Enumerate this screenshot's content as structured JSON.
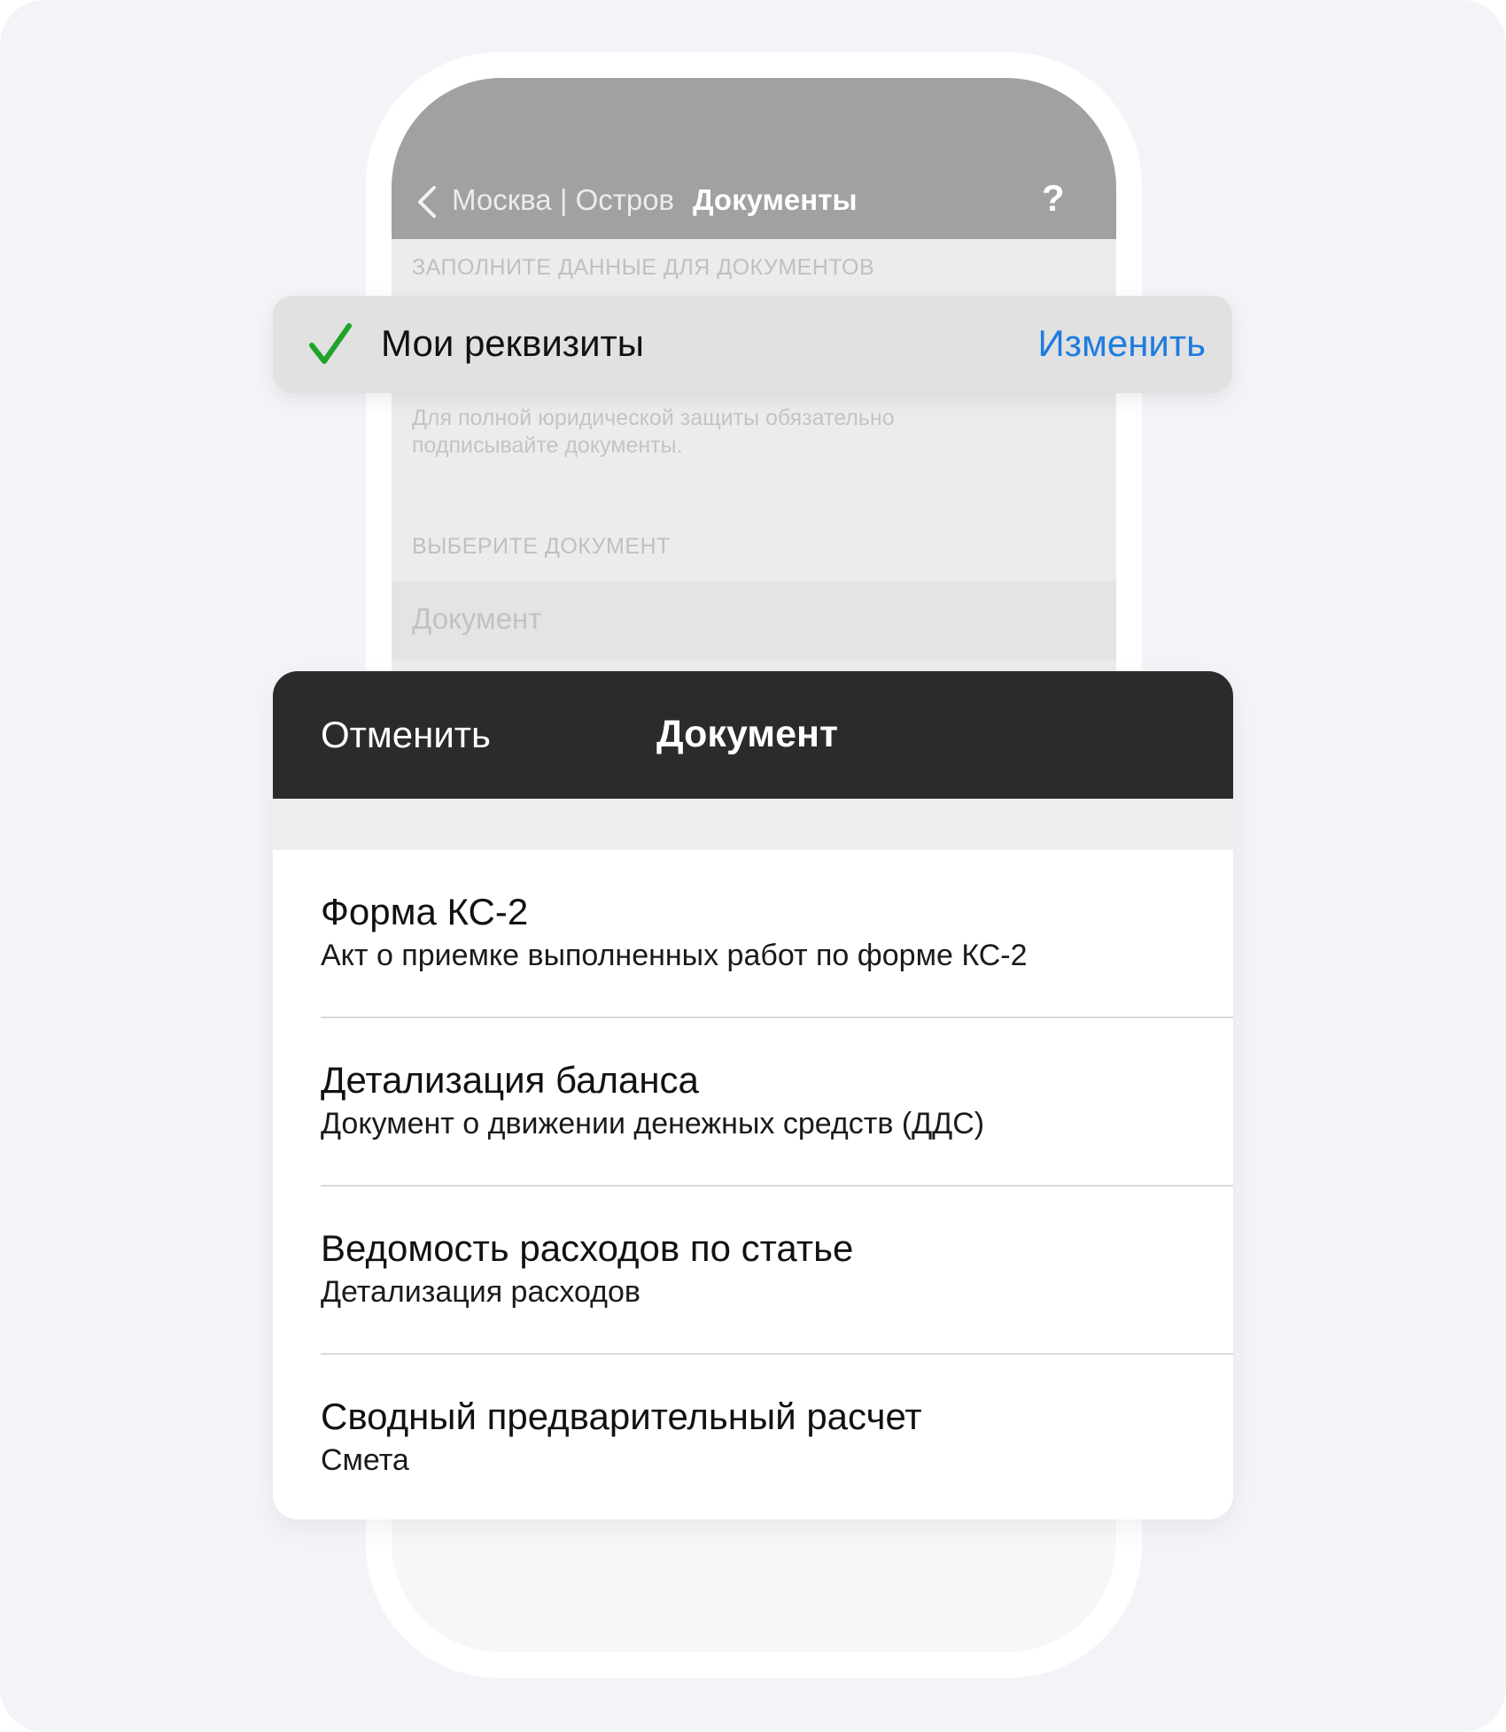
{
  "nav": {
    "breadcrumb": "Москва | Остров",
    "title": "Документы",
    "help": "?"
  },
  "form": {
    "fill_section_label": "ЗАПОЛНИТЕ ДАННЫЕ ДЛЯ ДОКУМЕНТОВ",
    "requisites_label": "Мои реквизиты",
    "requisites_edit": "Изменить",
    "hint": "Для полной юридической защиты обязательно подписывайте документы.",
    "choose_section_label": "ВЫБЕРИТЕ ДОКУМЕНТ",
    "document_placeholder": "Документ"
  },
  "picker": {
    "cancel_label": "Отменить",
    "title": "Документ",
    "items": [
      {
        "title": "Форма КС-2",
        "subtitle": "Акт о приемке выполненных работ по форме КС-2"
      },
      {
        "title": "Детализация баланса",
        "subtitle": "Документ о движении денежных средств (ДДС)"
      },
      {
        "title": "Ведомость расходов по статье",
        "subtitle": "Детализация расходов"
      },
      {
        "title": "Сводный предварительный расчет",
        "subtitle": "Смета"
      }
    ]
  },
  "colors": {
    "accent_link": "#1e7ce0",
    "check_green": "#1fa32a",
    "sheet_header": "#2b2b2b",
    "nav_bar": "#a1a1a1"
  },
  "icons": {
    "back": "chevron-left-icon",
    "requisites_status": "checkmark-icon"
  }
}
